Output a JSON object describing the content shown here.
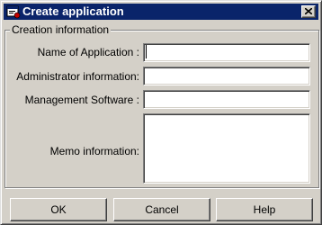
{
  "window": {
    "title": "Create application",
    "icon": "application-icon",
    "close_icon": "close-icon"
  },
  "group": {
    "legend": "Creation information"
  },
  "fields": {
    "name": {
      "label": "Name of Application :",
      "value": ""
    },
    "admin": {
      "label": "Administrator information:",
      "value": ""
    },
    "software": {
      "label": "Management Software :",
      "value": ""
    },
    "memo": {
      "label": "Memo information:",
      "value": ""
    }
  },
  "buttons": {
    "ok": "OK",
    "cancel": "Cancel",
    "help": "Help"
  },
  "colors": {
    "face": "#d4d0c8",
    "titlebar": "#0a246a"
  }
}
